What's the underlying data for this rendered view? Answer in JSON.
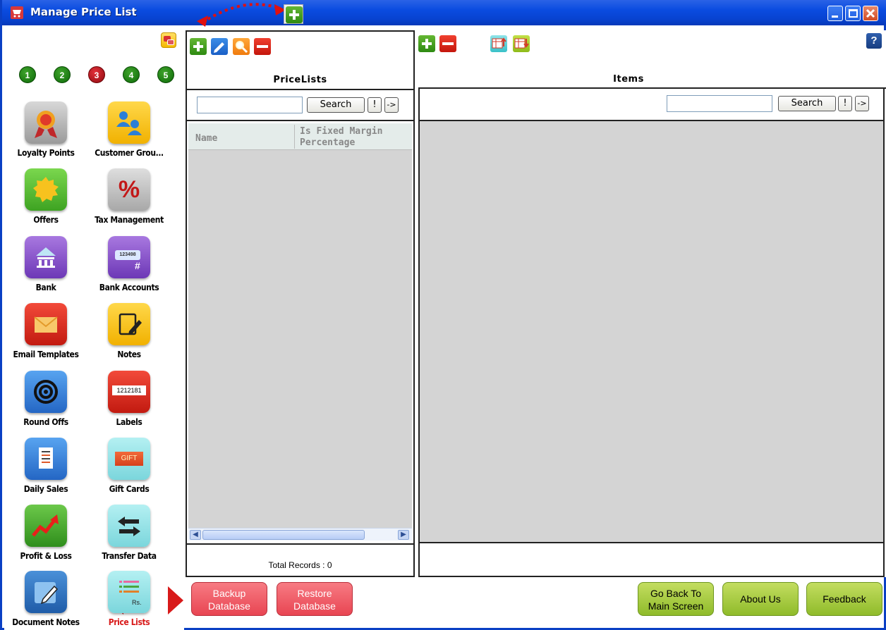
{
  "window": {
    "title": "Manage Price List",
    "help_label": "?"
  },
  "sidebar": {
    "page_numbers": [
      "1",
      "2",
      "3",
      "4",
      "5"
    ],
    "active_page": "3",
    "tiles": [
      {
        "label": "Loyalty Points",
        "icon": "ribbon-award-icon",
        "color": "#b5b5b5"
      },
      {
        "label": "Customer Grou...",
        "icon": "people-icon",
        "color": "#f6c21a"
      },
      {
        "label": "Offers",
        "icon": "offer-badge-icon",
        "color": "#5fc13a"
      },
      {
        "label": "Tax Management",
        "icon": "percent-icon",
        "color": "#b8b8b8"
      },
      {
        "label": "Bank",
        "icon": "bank-icon",
        "color": "#8a52c8"
      },
      {
        "label": "Bank Accounts",
        "icon": "account-number-icon",
        "color": "#8a52c8"
      },
      {
        "label": "Email Templates",
        "icon": "envelope-icon",
        "color": "#e22c24"
      },
      {
        "label": "Notes",
        "icon": "note-pencil-icon",
        "color": "#f6c21a"
      },
      {
        "label": "Round Offs",
        "icon": "target-icon",
        "color": "#3d88e0"
      },
      {
        "label": "Labels",
        "icon": "barcode-label-icon",
        "color": "#e22c24"
      },
      {
        "label": "Daily Sales",
        "icon": "report-icon",
        "color": "#3d88e0"
      },
      {
        "label": "Gift Cards",
        "icon": "gift-card-icon",
        "color": "#8fe3e8"
      },
      {
        "label": "Profit & Loss",
        "icon": "trend-arrow-icon",
        "color": "#4fb236"
      },
      {
        "label": "Transfer Data",
        "icon": "transfer-arrows-icon",
        "color": "#8fe3e8"
      },
      {
        "label": "Document Notes",
        "icon": "document-pencil-icon",
        "color": "#2f78c8"
      },
      {
        "label": "Price Lists",
        "icon": "price-list-icon",
        "color": "#8fe3e8"
      }
    ],
    "glyphs": {
      "percent": "%",
      "account_number": "123498",
      "hash": "#",
      "labels_text": "1212181",
      "gift_text": "GIFT",
      "rs": "Rs."
    }
  },
  "pricelists": {
    "title": "PriceLists",
    "search_value": "",
    "search_label": "Search",
    "bang_label": "!",
    "go_label": "->",
    "columns": [
      "Name",
      "Is Fixed Margin Percentage"
    ],
    "rows": [],
    "total_records": "Total Records : 0"
  },
  "items": {
    "title": "Items",
    "search_value": "",
    "search_label": "Search",
    "bang_label": "!",
    "go_label": "->"
  },
  "footer": {
    "backup_label": "Backup Database",
    "restore_label": "Restore Database",
    "go_back_label": "Go Back To Main Screen",
    "about_label": "About Us",
    "feedback_label": "Feedback"
  }
}
